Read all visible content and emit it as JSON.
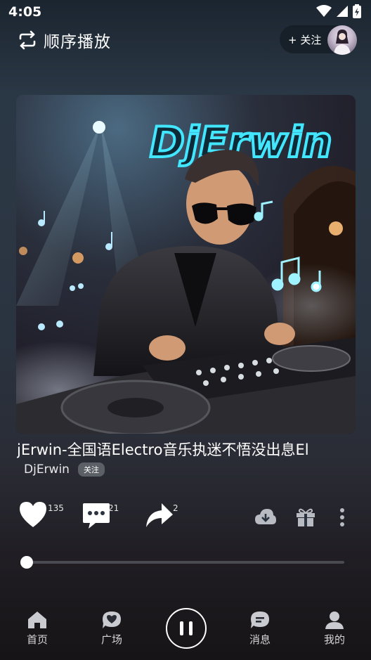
{
  "status_bar": {
    "time": "4:05"
  },
  "header": {
    "play_mode": "顺序播放",
    "follow_label": "+ 关注"
  },
  "cover": {
    "title_art": "DjErwin"
  },
  "song": {
    "title": "jErwin-全国语Electro音乐执迷不悟没出息El",
    "artist": "DjErwin",
    "follow_badge": "关注"
  },
  "actions": {
    "likes": "135",
    "comments": "21",
    "shares": "2"
  },
  "progress": {
    "fraction": 0.0
  },
  "nav": [
    {
      "label": "首页",
      "icon": "home-icon"
    },
    {
      "label": "广场",
      "icon": "square-heart-icon"
    },
    {
      "label": "消息",
      "icon": "message-icon"
    },
    {
      "label": "我的",
      "icon": "profile-icon"
    }
  ],
  "colors": {
    "cyan_neon": "#43e6ff",
    "accent_white": "#ffffff"
  }
}
